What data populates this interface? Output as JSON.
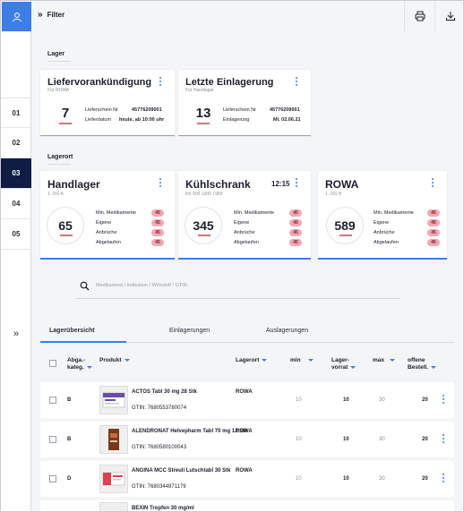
{
  "topbar": {
    "filter_label": "Filter"
  },
  "rail": {
    "items": [
      "01",
      "02",
      "03",
      "04",
      "05"
    ],
    "active": "03"
  },
  "lager": {
    "section_title": "Lager",
    "cards": [
      {
        "title": "Liefervorankündigung",
        "subtitle": "Für ROWA",
        "count": "7",
        "kv": [
          {
            "k": "Lieferschein Nr",
            "v": "45776209001"
          },
          {
            "k": "Lieferdatum",
            "v": "heute, ab 10:00 uhr"
          }
        ]
      },
      {
        "title": "Letzte Einlagerung",
        "subtitle": "Für Handlager",
        "count": "13",
        "kv": [
          {
            "k": "Lieferschein Nr",
            "v": "45776209001"
          },
          {
            "k": "Einlagerung",
            "v": "Mi. 02.06.21"
          }
        ]
      }
    ]
  },
  "lagerort": {
    "section_title": "Lagerort",
    "cards": [
      {
        "title": "Handlager",
        "subtitle": "1. OG A",
        "time": "",
        "count": "65"
      },
      {
        "title": "Kühlschrank",
        "subtitle": "KK 000 1006 1969",
        "time": "12:15",
        "count": "345"
      },
      {
        "title": "ROWA",
        "subtitle": "1. OG H",
        "time": "",
        "count": "589"
      }
    ],
    "stat_labels": [
      "Min. Medikamente",
      "Eigene",
      "Anbrüche",
      "Abgelaufen"
    ],
    "stat_value": "45"
  },
  "search": {
    "placeholder": "Medikament  /  Indikation  /  Wirkstoff  /  GTIN"
  },
  "tabs": [
    "Lagerübersicht",
    "Einlagerungen",
    "Auslagerungen"
  ],
  "table": {
    "headers": {
      "abga": "Abga.- kateg.",
      "produkt": "Produkt",
      "lagerort": "Lagerort",
      "min": "min",
      "lagervorrat": "Lager- vorrat",
      "max": "max",
      "offene": "offene Bestell."
    },
    "rows": [
      {
        "kat": "B",
        "name": "ACTOS Tabl 30 mg 28 Stk",
        "gtin": "GTIN: 7680553780074",
        "lagerort": "ROWA",
        "min": "10",
        "vorrat": "10",
        "max": "30",
        "offen": "20"
      },
      {
        "kat": "B",
        "name": "ALENDRONAT Helvepharm Tabl 70 mg 12 Stk",
        "gtin": "GTIN: 7680580100043",
        "lagerort": "ROWA",
        "min": "10",
        "vorrat": "10",
        "max": "30",
        "offen": "20"
      },
      {
        "kat": "D",
        "name": "ANGINA MCC Streuli Lutschtabl 30 Stk",
        "gtin": "GTIN: 7680344971179",
        "lagerort": "ROWA",
        "min": "10",
        "vorrat": "10",
        "max": "30",
        "offen": "20"
      },
      {
        "kat": "",
        "name": "BEXIN Tropfen 30 mg/ml",
        "gtin": "",
        "lagerort": "",
        "min": "",
        "vorrat": "",
        "max": "",
        "offen": ""
      }
    ]
  }
}
